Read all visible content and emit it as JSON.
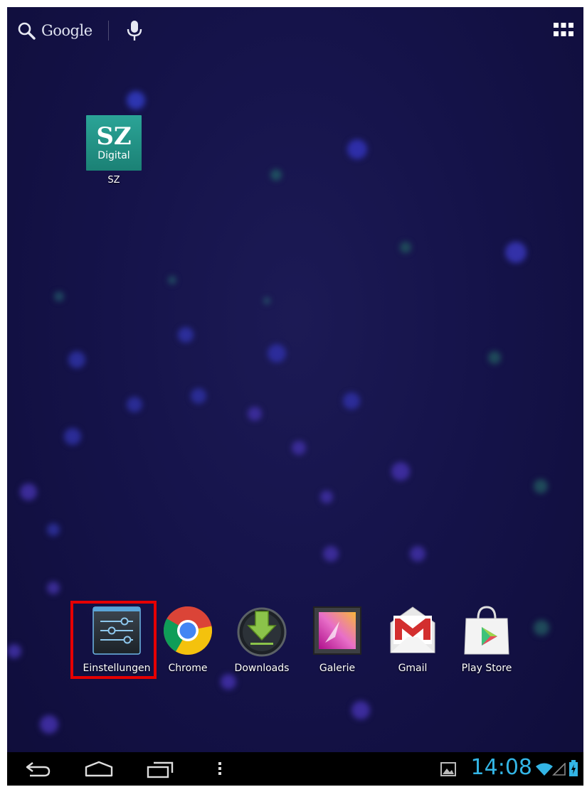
{
  "search_bar": {
    "label": "Google",
    "icon": "search-icon",
    "voice_icon": "mic-icon"
  },
  "apps_button": {
    "icon": "all-apps-icon"
  },
  "shortcuts": [
    {
      "label": "SZ",
      "logo_text": "SZ",
      "logo_subtext": "Digital",
      "icon": "sz-digital-icon"
    }
  ],
  "dock": [
    {
      "label": "Einstellungen",
      "icon": "settings-icon",
      "highlighted": true
    },
    {
      "label": "Chrome",
      "icon": "chrome-icon"
    },
    {
      "label": "Downloads",
      "icon": "downloads-icon"
    },
    {
      "label": "Galerie",
      "icon": "gallery-icon"
    },
    {
      "label": "Gmail",
      "icon": "gmail-icon"
    },
    {
      "label": "Play Store",
      "icon": "play-store-icon"
    }
  ],
  "navigation": {
    "back": "back-icon",
    "home": "home-icon",
    "recents": "recent-apps-icon",
    "menu": "menu-icon"
  },
  "status_bar": {
    "time": "14:08",
    "icons": [
      "screenshot-notification-icon",
      "wifi-icon",
      "signal-icon",
      "battery-charging-icon"
    ]
  },
  "colors": {
    "clock": "#33b5e5",
    "highlight": "#e60000",
    "wallpaper": "#15134a"
  }
}
